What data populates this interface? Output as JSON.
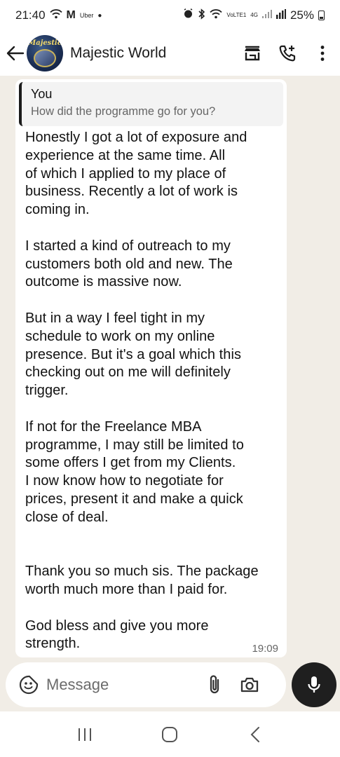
{
  "status_bar": {
    "time": "21:40",
    "app_label": "Uber",
    "volte_label": "VoLTE1",
    "network_label": "4G",
    "battery": "25%"
  },
  "header": {
    "contact_name": "Majestic World",
    "avatar_text": "Majestic"
  },
  "message": {
    "quote_author": "You",
    "quote_text": "How did the programme go for you?",
    "body": "Honestly I got a lot of exposure and\nexperience at the same time. All\nof which I applied to my place of\nbusiness. Recently a lot of work is\ncoming in.\n\nI started a kind of outreach to my\ncustomers both old and new. The\noutcome is massive now.\n\nBut in a way I feel tight in my\nschedule to work on my online\npresence. But it's a goal which this\nchecking out on me will definitely\ntrigger.\n\nIf not for the Freelance MBA\nprogramme, I may still be limited to\nsome offers I get from my Clients.\nI now know how to negotiate for\nprices, present it and make a quick\nclose of deal.\n\n\nThank you so much sis. The package\nworth much more than I paid for.\n\nGod bless and give you more\nstrength.",
    "time": "19:09"
  },
  "composer": {
    "placeholder": "Message"
  },
  "colors": {
    "chat_background": "#f1ede6",
    "bubble": "#ffffff",
    "mic_button": "#1f1f1f"
  }
}
